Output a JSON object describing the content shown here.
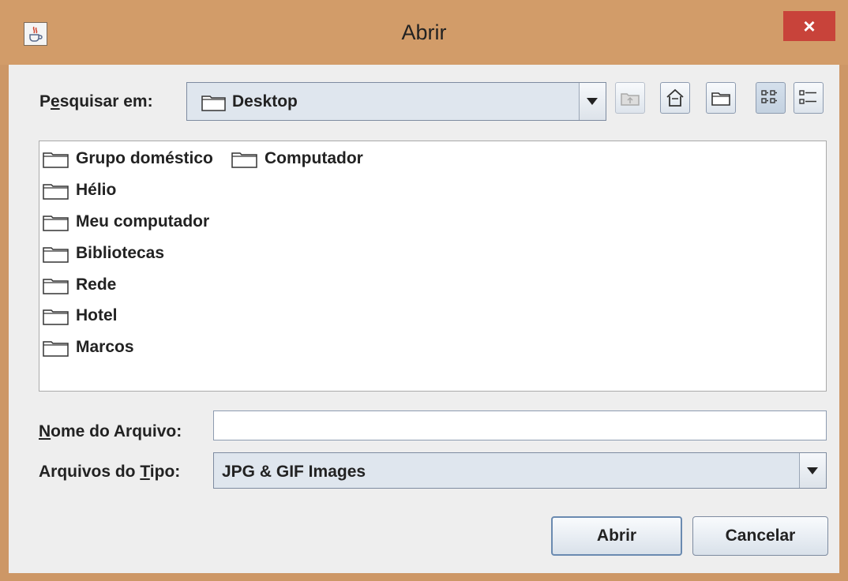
{
  "window": {
    "title": "Abrir",
    "close_glyph": "×",
    "app_icon": "java-cup-icon"
  },
  "lookin": {
    "label_pre": "P",
    "label_mnemonic": "e",
    "label_post": "squisar em:",
    "value": "Desktop",
    "toolbar": [
      "up-folder-icon",
      "home-icon",
      "new-folder-icon",
      "list-view-icon",
      "details-view-icon"
    ]
  },
  "files": [
    {
      "name": "Grupo doméstico"
    },
    {
      "name": "Computador"
    },
    {
      "name": "Hélio"
    },
    {
      "name": "Meu computador"
    },
    {
      "name": "Bibliotecas"
    },
    {
      "name": "Rede"
    },
    {
      "name": "Hotel"
    },
    {
      "name": "Marcos"
    }
  ],
  "filename": {
    "label_mnemonic": "N",
    "label_post": "ome do Arquivo:",
    "value": ""
  },
  "filetype": {
    "label_pre": "Arquivos do ",
    "label_mnemonic": "T",
    "label_post": "ipo:",
    "value": "JPG & GIF Images"
  },
  "buttons": {
    "open": "Abrir",
    "cancel": "Cancelar"
  }
}
